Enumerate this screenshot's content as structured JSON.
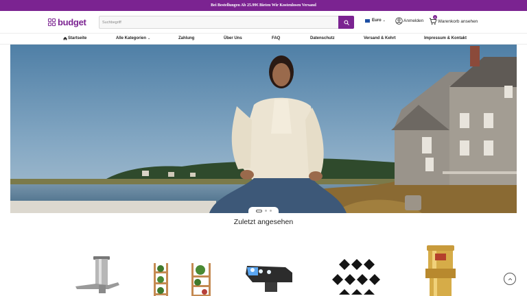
{
  "promo": {
    "text": "Bei Bestellungen Ab 25.99€ Bieten Wir Kostenlosen Versand"
  },
  "header": {
    "logo_text": "budget",
    "search": {
      "placeholder": "Suchbegriff",
      "value": ""
    },
    "currency": {
      "label": "Euro"
    },
    "login_label": "Anmelden",
    "cart": {
      "label": "Warenkorb ansehen",
      "count": "0"
    }
  },
  "nav": {
    "items": [
      {
        "label": "Startseite",
        "icon": "home-icon"
      },
      {
        "label": "Alle Kategorien",
        "icon": "chevron-down-icon"
      },
      {
        "label": "Zahlung"
      },
      {
        "label": "Über Uns"
      },
      {
        "label": "FAQ"
      },
      {
        "label": "Datenschutz"
      },
      {
        "label": "Versand & Kehrt"
      },
      {
        "label": "Impressum & Kontakt"
      }
    ]
  },
  "hero": {
    "slides": 3,
    "active_slide": 1
  },
  "recent": {
    "title": "Zuletzt angesehen",
    "products": [
      {
        "icon": "beer-tap-icon"
      },
      {
        "icon": "plant-stand-icon"
      },
      {
        "icon": "car-light-icon"
      },
      {
        "icon": "rubber-pads-icon"
      },
      {
        "icon": "brass-fitting-icon"
      }
    ]
  },
  "colors": {
    "brand": "#7b2391",
    "promo_bg": "#7b2391",
    "flag": "#1e4fa3"
  }
}
